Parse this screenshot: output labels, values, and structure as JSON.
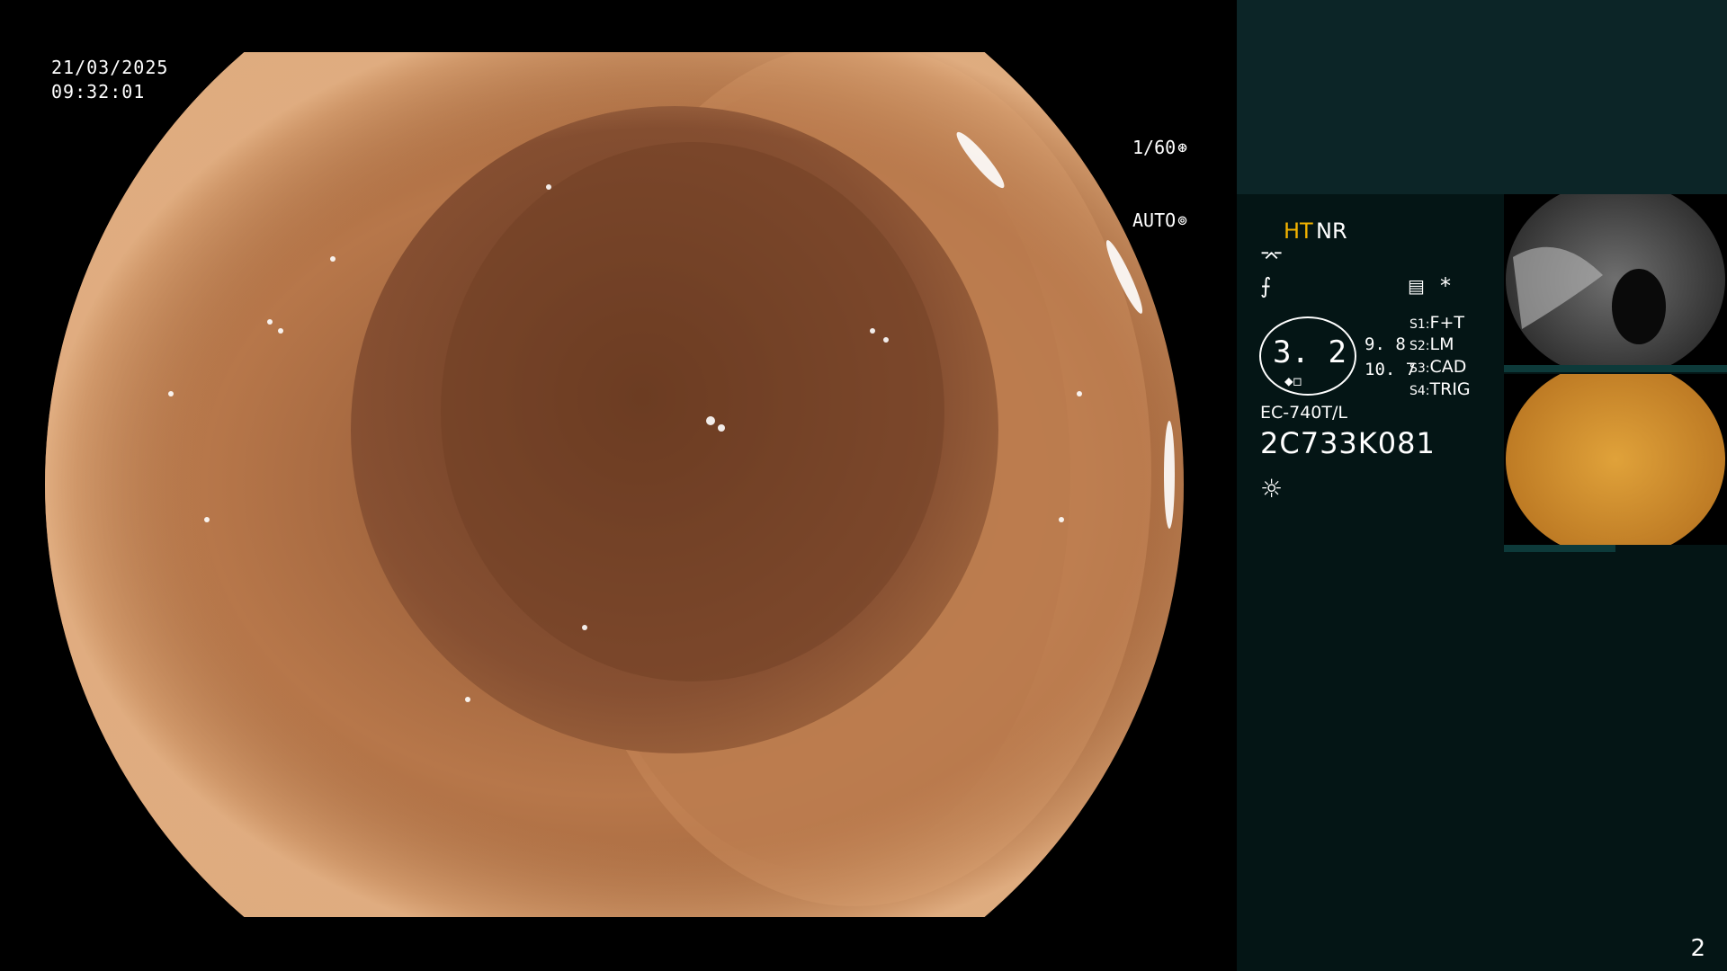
{
  "overlay": {
    "date": "21/03/2025",
    "time": "09:32:01",
    "shutter": "1/60",
    "shutter_icon": "aperture-icon",
    "iris_mode": "AUTO",
    "iris_icon": "iris-icon"
  },
  "panel": {
    "ht": "HT",
    "nr": "NR",
    "enhance_icon_1": "⌤",
    "enhance_icon_2": "⨍",
    "image_icon": "▤",
    "star": "*",
    "zoom_value": "3. 2",
    "zoom_a": "9. 8",
    "zoom_b": "10. 7",
    "switches": [
      {
        "key": "S1:",
        "label": "F+T"
      },
      {
        "key": "S2:",
        "label": "LM"
      },
      {
        "key": "S3:",
        "label": "CAD"
      },
      {
        "key": "S4:",
        "label": "TRIG"
      }
    ],
    "model": "EC-740T/L",
    "serial": "2C733K081",
    "light_icon": "☼"
  },
  "page_number": "2",
  "colors": {
    "panel_bg": "#041515",
    "panel_top_bg": "#0c2527",
    "ht_accent": "#f2b200",
    "tissue_mid": "#b7774a",
    "tissue_dark": "#6a3b22"
  }
}
